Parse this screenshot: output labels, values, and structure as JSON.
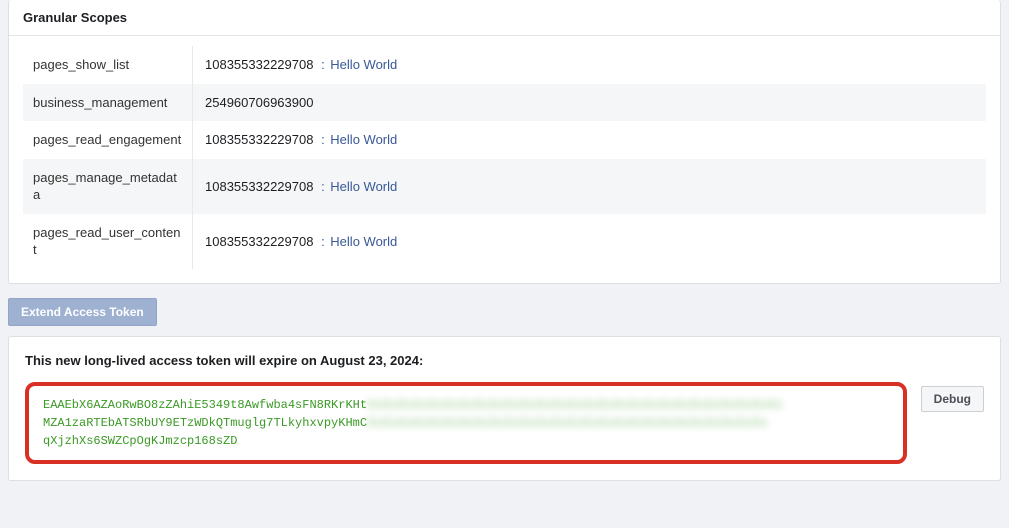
{
  "scopes_section": {
    "title": "Granular Scopes",
    "rows": [
      {
        "name": "pages_show_list",
        "id": "108355332229708",
        "link": "Hello World"
      },
      {
        "name": "business_management",
        "id": "254960706963900",
        "link": null
      },
      {
        "name": "pages_read_engagement",
        "id": "108355332229708",
        "link": "Hello World"
      },
      {
        "name": "pages_manage_metadata",
        "id": "108355332229708",
        "link": "Hello World"
      },
      {
        "name": "pages_read_user_content",
        "id": "108355332229708",
        "link": "Hello World"
      }
    ]
  },
  "extend_button_label": "Extend Access Token",
  "token_section": {
    "heading": "This new long-lived access token will expire on August 23, 2024:",
    "token_lines": [
      {
        "visible": "EAAEbX6AZAoRwBO8zZAhiE5349t8Awfwba4sFN8RKrKHt",
        "blurred": "XxXxXxXxXxXxXxXxXxXxXxXxXxXxXxXxXxXxXxXxXxXxXxXxXxXxXx"
      },
      {
        "visible": "MZA1zaRTEbATSRbUY9ETzWDkQTmuglg7TLkyhxvpyKHmC",
        "blurred": "XxXxXxXxXxXxXxXxXxXxXxXxXxXxXxXxXxXxXxXxXxXxXxXxXxXx"
      },
      {
        "visible": "qXjzhXs6SWZCpOgKJmzcp168sZD",
        "blurred": ""
      }
    ],
    "debug_label": "Debug"
  }
}
